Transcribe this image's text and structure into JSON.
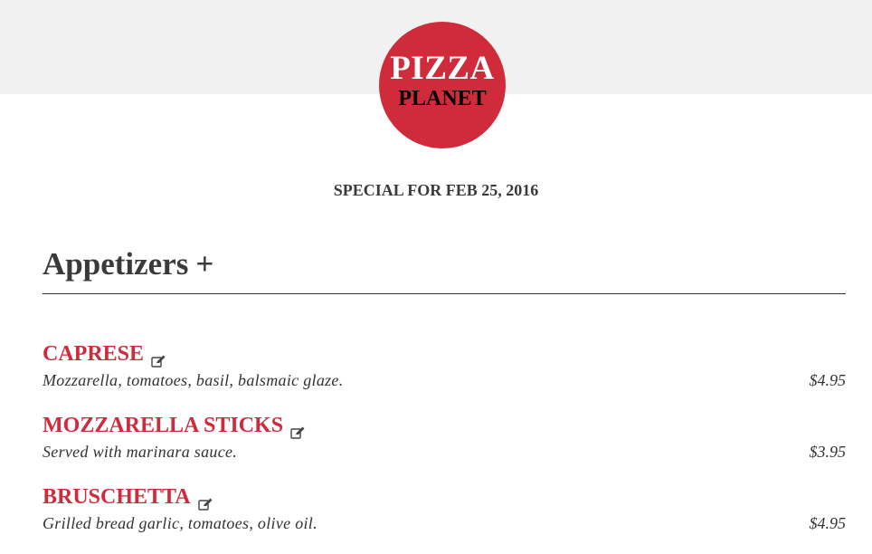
{
  "logo": {
    "line1": "PIZZA",
    "line2": "PLANET"
  },
  "special": {
    "label": "SPECIAL FOR FEB 25, 2016"
  },
  "section": {
    "title": "Appetizers",
    "toggle": "+"
  },
  "menu_items": [
    {
      "name": "CAPRESE",
      "description": "Mozzarella, tomatoes, basil, balsmaic glaze.",
      "price": "$4.95",
      "icon": "edit-icon"
    },
    {
      "name": "MOZZARELLA STICKS",
      "description": "Served with marinara sauce.",
      "price": "$3.95",
      "icon": "edit-icon"
    },
    {
      "name": "BRUSCHETTA",
      "description": "Grilled bread garlic, tomatoes, olive oil.",
      "price": "$4.95",
      "icon": "edit-icon"
    }
  ],
  "colors": {
    "brand_red": "#cf2b3a",
    "band_gray": "#f1f1f1",
    "text_dark": "#3a3a3a"
  }
}
